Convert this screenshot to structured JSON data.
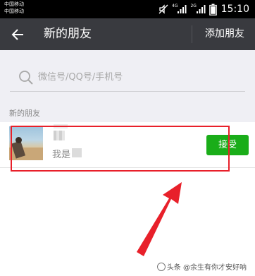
{
  "status_bar": {
    "carrier_line1": "中国移动",
    "carrier_line2": "中国移动",
    "network_label_1": "4G",
    "network_label_2": "2G",
    "time": "15:10"
  },
  "app_bar": {
    "title": "新的朋友",
    "action_label": "添加朋友"
  },
  "search": {
    "placeholder": "微信号/QQ号/手机号"
  },
  "section": {
    "label": "新的朋友"
  },
  "friend_request": {
    "message_prefix": "我是",
    "accept_label": "接受"
  },
  "watermark": {
    "text": "头条 @余生有你才安好呐"
  },
  "colors": {
    "app_bar": "#393a3f",
    "accept_button": "#1aad19",
    "highlight": "#e8202a",
    "page_background": "#efeff4"
  }
}
